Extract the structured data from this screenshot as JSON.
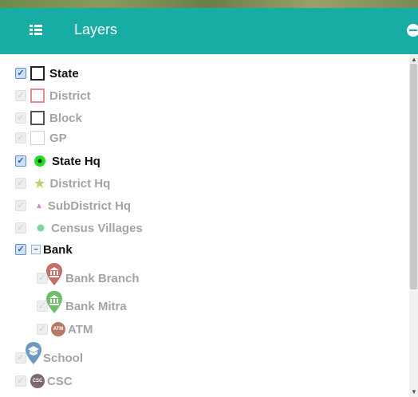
{
  "header": {
    "title": "Layers",
    "menu_icon": "list-icon",
    "collapse_icon": "minus-circle-icon"
  },
  "colors": {
    "header_bg": "#17ada4",
    "active_text": "#111111",
    "inactive_text": "#a4a4a4"
  },
  "layers": [
    {
      "label": "State",
      "checked": true,
      "symbol": "black-square-outline"
    },
    {
      "label": "District",
      "checked": false,
      "symbol": "pink-square-outline"
    },
    {
      "label": "Block",
      "checked": false,
      "symbol": "dark-square-outline"
    },
    {
      "label": "GP",
      "checked": false,
      "symbol": "light-square-outline"
    },
    {
      "label": "State Hq",
      "checked": true,
      "symbol": "green-dot-icon"
    },
    {
      "label": "District Hq",
      "checked": false,
      "symbol": "star-icon"
    },
    {
      "label": "SubDistrict Hq",
      "checked": false,
      "symbol": "triangle-icon"
    },
    {
      "label": "Census Villages",
      "checked": false,
      "symbol": "green-circle-icon"
    },
    {
      "label": "Bank",
      "checked": true,
      "symbol": "collapse-minus-icon"
    },
    {
      "label": "Bank Branch",
      "checked": false,
      "symbol": "bank-pin-icon"
    },
    {
      "label": "Bank Mitra",
      "checked": false,
      "symbol": "bank-pin-icon"
    },
    {
      "label": "ATM",
      "checked": false,
      "symbol": "atm-icon"
    },
    {
      "label": "School",
      "checked": false,
      "symbol": "school-pin-icon"
    },
    {
      "label": "CSC",
      "checked": false,
      "symbol": "csc-icon"
    }
  ],
  "badges": {
    "atm": "ATM",
    "csc": "CSC"
  }
}
